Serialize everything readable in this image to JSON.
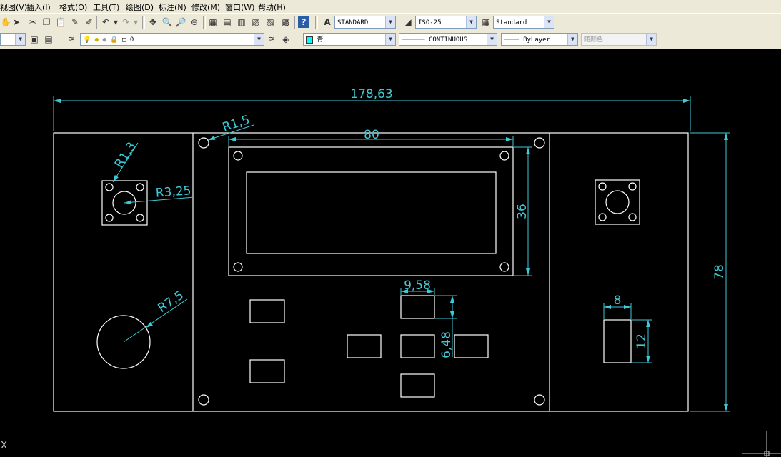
{
  "menu": {
    "items": [
      "视图(V)",
      "插入(I)",
      "格式(O)",
      "工具(T)",
      "绘图(D)",
      "标注(N)",
      "修改(M)",
      "窗口(W)",
      "帮助(H)"
    ]
  },
  "styles": {
    "text_style": "STANDARD",
    "dim_style": "ISO-25",
    "table_style": "Standard"
  },
  "layers": {
    "current_layer": "0",
    "color": "青",
    "color_hex": "#00ffff",
    "linetype": "CONTINUOUS",
    "lineweight": "ByLayer",
    "plot_style": "随颜色"
  },
  "colors": {
    "geometry": "#ffffff",
    "dimension": "#3ec9d6",
    "background": "#000000"
  },
  "dimensions": {
    "overall_width": "178,63",
    "screen_width": "80",
    "screen_height": "36",
    "overall_height": "78",
    "hole_radius_small": "R1,5",
    "button_hole_radius": "R1,3",
    "button_radius": "R3,25",
    "knob_radius": "R7,5",
    "key_width": "9,58",
    "key_height": "6,48",
    "slot_width": "8",
    "slot_height": "12"
  },
  "ucs": {
    "axis_label": "X"
  }
}
